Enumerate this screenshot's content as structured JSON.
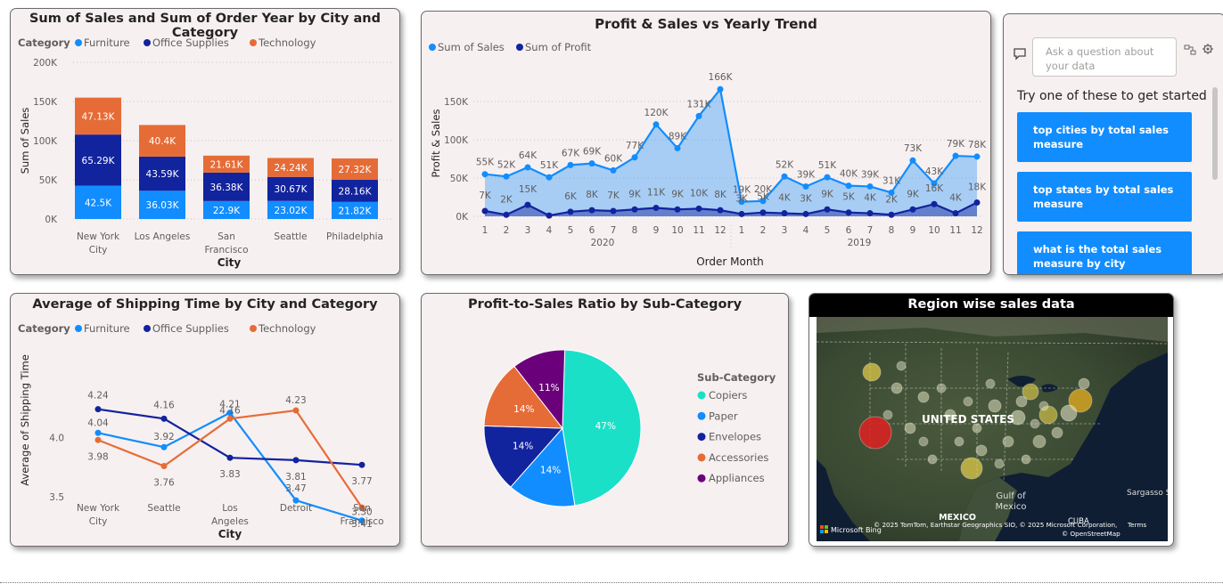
{
  "card1": {
    "title": "Sum of Sales and Sum of Order Year by City and Category",
    "legend_title": "Category",
    "legend": [
      "Furniture",
      "Office Supplies",
      "Technology"
    ],
    "ylabel": "Sum of Sales",
    "xlabel": "City",
    "yticks": [
      "200K",
      "150K",
      "100K",
      "50K",
      "0K"
    ],
    "cities": [
      [
        "New York",
        "City"
      ],
      [
        "Los Angeles"
      ],
      [
        "San",
        "Francisco"
      ],
      [
        "Seattle"
      ],
      [
        "Philadelphia"
      ]
    ],
    "labels": {
      "furniture": [
        "42.5K",
        "36.03K",
        "22.9K",
        "23.02K",
        "21.82K"
      ],
      "office": [
        "65.29K",
        "43.59K",
        "36.38K",
        "30.67K",
        "28.16K"
      ],
      "technology": [
        "47.13K",
        "40.4K",
        "21.61K",
        "24.24K",
        "27.32K"
      ]
    }
  },
  "card2": {
    "title": "Profit & Sales vs Yearly Trend",
    "legend": [
      "Sum of Sales",
      "Sum of Profit"
    ],
    "ylabel": "Profit & Sales",
    "xlabel": "Order Month",
    "yticks": [
      "150K",
      "100K",
      "50K",
      "0K"
    ],
    "months": [
      "1",
      "2",
      "3",
      "4",
      "5",
      "6",
      "7",
      "8",
      "9",
      "10",
      "11",
      "12",
      "1",
      "2",
      "3",
      "4",
      "5",
      "6",
      "7",
      "8",
      "9",
      "10",
      "11",
      "12"
    ],
    "years": [
      "2020",
      "2019"
    ],
    "sales_labels": [
      "55K",
      "52K",
      "64K",
      "51K",
      "67K",
      "69K",
      "60K",
      "77K",
      "120K",
      "89K",
      "131K",
      "166K",
      "19K",
      "20K",
      "52K",
      "39K",
      "51K",
      "40K",
      "39K",
      "31K",
      "73K",
      "43K",
      "79K",
      "78K"
    ],
    "profit_labels": [
      "7K",
      "2K",
      "15K",
      "",
      "6K",
      "8K",
      "7K",
      "9K",
      "11K",
      "9K",
      "10K",
      "8K",
      "3K",
      "5K",
      "4K",
      "3K",
      "9K",
      "5K",
      "4K",
      "2K",
      "9K",
      "16K",
      "4K",
      "18K"
    ]
  },
  "qa": {
    "placeholder": "Ask a question about your data",
    "prompt": "Try one of these to get started",
    "suggestions": [
      "top cities by total sales measure",
      "top states by total sales measure",
      "what is the total sales measure by city"
    ]
  },
  "card3": {
    "title": "Average of Shipping Time by City and Category",
    "legend_title": "Category",
    "legend": [
      "Furniture",
      "Office Supplies",
      "Technology"
    ],
    "ylabel": "Average of Shipping Time",
    "xlabel": "City",
    "yticks": [
      "4.0",
      "3.5"
    ],
    "cities": [
      [
        "New York",
        "City"
      ],
      [
        "Seattle"
      ],
      [
        "Los",
        "Angeles"
      ],
      [
        "Detroit"
      ],
      [
        "San",
        "Francisco"
      ]
    ],
    "furniture_labels": [
      "4.04",
      "3.92",
      "4.21",
      "3.47",
      "3.30"
    ],
    "office_labels": [
      "4.24",
      "4.16",
      "3.83",
      "3.81",
      "3.77"
    ],
    "technology_labels": [
      "3.98",
      "3.76",
      "4.16",
      "4.23",
      "3.41"
    ]
  },
  "card4": {
    "title": "Profit-to-Sales Ratio by Sub-Category",
    "legend_title": "Sub-Category",
    "legend": [
      "Copiers",
      "Paper",
      "Envelopes",
      "Accessories",
      "Appliances"
    ],
    "slice_labels": [
      "47%",
      "14%",
      "14%",
      "14%",
      "11%"
    ]
  },
  "card5": {
    "title": "Region wise sales data",
    "country": "UNITED STATES",
    "gulf": [
      "Gulf of",
      "Mexico"
    ],
    "mexico": "MEXICO",
    "sargasso": "Sargasso Se",
    "cuba": "CUBA",
    "bing": "Microsoft Bing",
    "attribution": "© 2025 TomTom, Earthstar Geographics SIO, © 2025 Microsoft Corporation,",
    "terms": "Terms",
    "osm": "© OpenStreetMap"
  },
  "chart_data": [
    {
      "type": "bar",
      "title": "Sum of Sales and Sum of Order Year by City and Category",
      "xlabel": "City",
      "ylabel": "Sum of Sales",
      "stacked": true,
      "categories": [
        "New York City",
        "Los Angeles",
        "San Francisco",
        "Seattle",
        "Philadelphia"
      ],
      "ylim": [
        0,
        200000
      ],
      "series": [
        {
          "name": "Furniture",
          "values": [
            42500,
            36030,
            22900,
            23020,
            21820
          ]
        },
        {
          "name": "Office Supplies",
          "values": [
            65290,
            43590,
            36380,
            30670,
            28160
          ]
        },
        {
          "name": "Technology",
          "values": [
            47130,
            40400,
            21610,
            24240,
            27320
          ]
        }
      ],
      "legend_position": "top-left",
      "colors": [
        "#118dff",
        "#12239e",
        "#e66c37"
      ]
    },
    {
      "type": "area",
      "title": "Profit & Sales vs Yearly Trend",
      "xlabel": "Order Month",
      "ylabel": "Profit & Sales",
      "ylim": [
        0,
        170000
      ],
      "x_groups": [
        {
          "year": "2020",
          "months": [
            1,
            2,
            3,
            4,
            5,
            6,
            7,
            8,
            9,
            10,
            11,
            12
          ]
        },
        {
          "year": "2019",
          "months": [
            1,
            2,
            3,
            4,
            5,
            6,
            7,
            8,
            9,
            10,
            11,
            12
          ]
        }
      ],
      "series": [
        {
          "name": "Sum of Sales",
          "values": [
            55000,
            52000,
            64000,
            51000,
            67000,
            69000,
            60000,
            77000,
            120000,
            89000,
            131000,
            166000,
            19000,
            20000,
            52000,
            39000,
            51000,
            40000,
            39000,
            31000,
            73000,
            43000,
            79000,
            78000
          ]
        },
        {
          "name": "Sum of Profit",
          "values": [
            7000,
            2000,
            15000,
            1000,
            6000,
            8000,
            7000,
            9000,
            11000,
            9000,
            10000,
            8000,
            3000,
            5000,
            4000,
            3000,
            9000,
            5000,
            4000,
            2000,
            9000,
            16000,
            4000,
            18000
          ]
        }
      ],
      "legend_position": "top-left",
      "colors": [
        "#118dff",
        "#12239e"
      ]
    },
    {
      "type": "line",
      "title": "Average of Shipping Time by City and Category",
      "xlabel": "City",
      "ylabel": "Average of Shipping Time",
      "categories": [
        "New York City",
        "Seattle",
        "Los Angeles",
        "Detroit",
        "San Francisco"
      ],
      "ylim": [
        3.2,
        4.4
      ],
      "series": [
        {
          "name": "Furniture",
          "values": [
            4.04,
            3.92,
            4.21,
            3.47,
            3.3
          ]
        },
        {
          "name": "Office Supplies",
          "values": [
            4.24,
            4.16,
            3.83,
            3.81,
            3.77
          ]
        },
        {
          "name": "Technology",
          "values": [
            3.98,
            3.76,
            4.16,
            4.23,
            3.41
          ]
        }
      ],
      "legend_position": "top-left",
      "colors": [
        "#118dff",
        "#12239e",
        "#e66c37"
      ]
    },
    {
      "type": "pie",
      "title": "Profit-to-Sales Ratio by Sub-Category",
      "categories": [
        "Copiers",
        "Paper",
        "Envelopes",
        "Accessories",
        "Appliances"
      ],
      "values": [
        47,
        14,
        14,
        14,
        11
      ],
      "legend_position": "right",
      "colors": [
        "#1ae0c8",
        "#118dff",
        "#12239e",
        "#e66c37",
        "#6b007b"
      ]
    }
  ]
}
